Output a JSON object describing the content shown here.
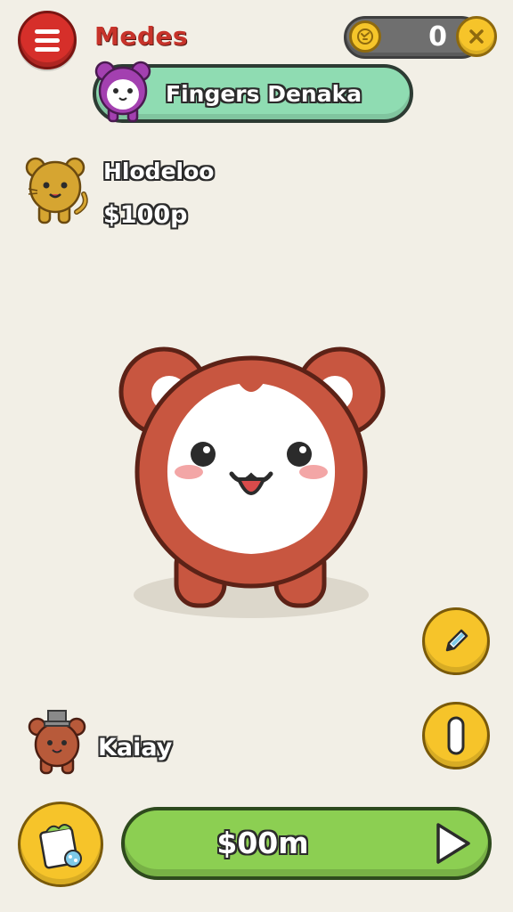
{
  "header": {
    "title": "Medes",
    "coins": "0",
    "menu_icon": "hamburger-menu-icon",
    "coin_icon": "coin-icon",
    "close_icon": "close-icon"
  },
  "banner": {
    "label": "Fingers Denaka",
    "avatar_icon": "purple-bear-avatar"
  },
  "player": {
    "name": "Hlodeloo",
    "money": "$100p",
    "avatar_icon": "yellow-cat-avatar"
  },
  "pet": {
    "icon": "red-bear-pet"
  },
  "side_buttons": {
    "edit_icon": "pencil-icon",
    "toggle_icon": "toggle-icon"
  },
  "companion": {
    "name": "Kaiay",
    "avatar_icon": "brown-bear-with-hat-avatar"
  },
  "bottom": {
    "food_icon": "food-bag-icon",
    "action_label": "$00m",
    "play_icon": "play-arrow-icon"
  },
  "colors": {
    "background": "#f2efe6",
    "menu_red": "#d62f2a",
    "title_red": "#c7332a",
    "banner_green": "#8fdcb2",
    "action_green": "#8ccf52",
    "button_yellow": "#f6c42a",
    "pet_red": "#c85640"
  }
}
